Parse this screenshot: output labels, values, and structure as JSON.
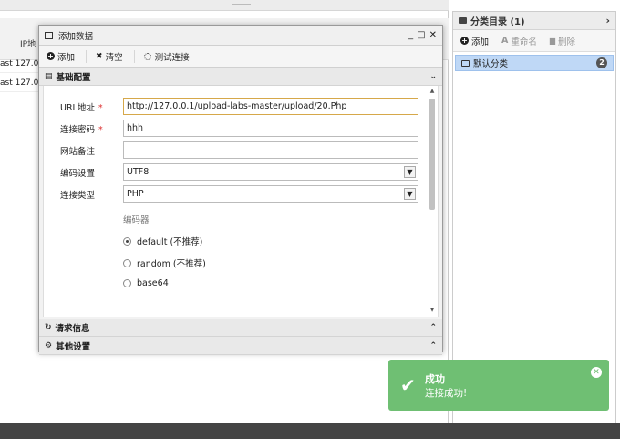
{
  "background_list": {
    "column_ip": "IP地",
    "rows": [
      "ast 127.0",
      "ast 127.0"
    ]
  },
  "category_panel": {
    "title": "分类目录 (1)",
    "add_label": "添加",
    "rename_label": "重命名",
    "delete_label": "删除",
    "items": [
      {
        "label": "默认分类",
        "count": "2"
      }
    ]
  },
  "dialog": {
    "title": "添加数据",
    "toolbar": {
      "add": "添加",
      "clear": "清空",
      "test": "测试连接"
    },
    "basic_section": "基础配置",
    "labels": {
      "url": "URL地址",
      "password": "连接密码",
      "note": "网站备注",
      "encoding": "编码设置",
      "type": "连接类型"
    },
    "required_mark": "*",
    "values": {
      "url": "http://127.0.0.1/upload-labs-master/upload/20.Php",
      "password": "hhh",
      "note": "",
      "encoding": "UTF8",
      "type": "PHP"
    },
    "encoder_title": "编码器",
    "encoders": [
      {
        "label": "default (不推荐)",
        "selected": true
      },
      {
        "label": "random (不推荐)",
        "selected": false
      },
      {
        "label": "base64",
        "selected": false
      }
    ],
    "request_section": "请求信息",
    "other_section": "其他设置"
  },
  "toast": {
    "title": "成功",
    "message": "连接成功!",
    "color": "#6fbf73"
  }
}
